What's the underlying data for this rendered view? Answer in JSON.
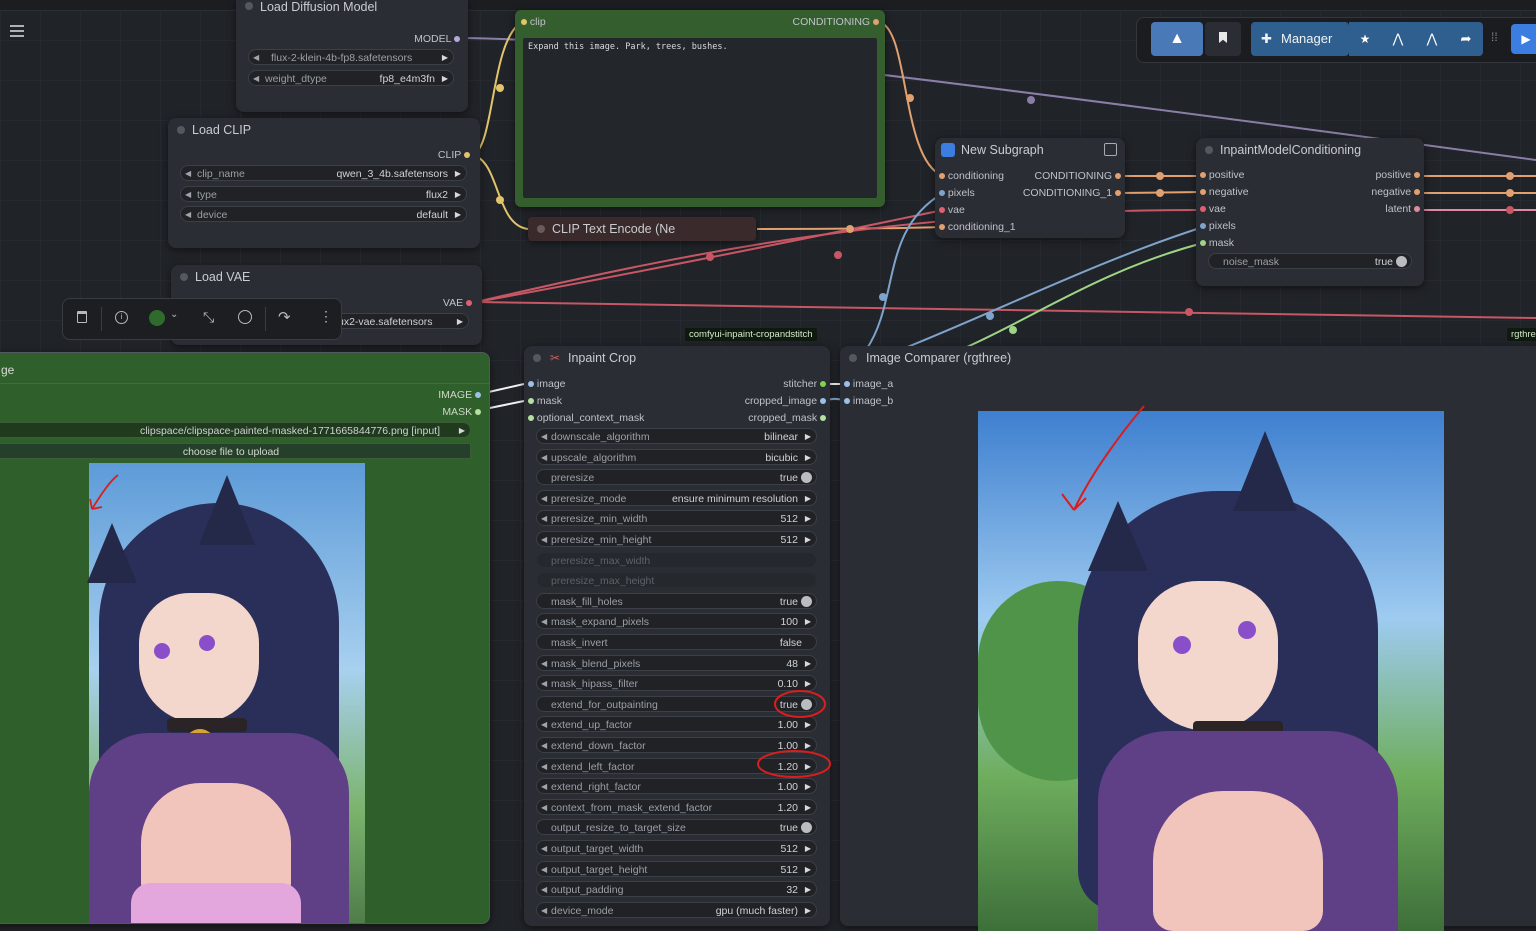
{
  "menu_icon": "hamburger-menu-icon",
  "toolbar": {
    "manager_label": "Manager",
    "icons": [
      "comfy-logo-icon",
      "bookmark-icon",
      "puzzle-icon",
      "star-icon",
      "lambda-icon",
      "lambda-alt-icon",
      "share-icon",
      "drag-handle-icon",
      "play-icon"
    ]
  },
  "selection_toolbar": {
    "icons": [
      "trash-icon",
      "info-icon",
      "color-dot-icon",
      "chevron-down-icon",
      "collapse-icon",
      "bypass-icon",
      "redo-icon",
      "more-icon"
    ],
    "color": "#2f6b2c"
  },
  "nodes": {
    "load_diffusion": {
      "title": "Load Diffusion Model",
      "output": "MODEL",
      "widgets": [
        {
          "label": "",
          "value": "flux-2-klein-4b-fp8.safetensors"
        },
        {
          "label": "weight_dtype",
          "value": "fp8_e4m3fn"
        }
      ]
    },
    "load_clip": {
      "title": "Load CLIP",
      "output": "CLIP",
      "widgets": [
        {
          "label": "clip_name",
          "value": "qwen_3_4b.safetensors"
        },
        {
          "label": "type",
          "value": "flux2"
        },
        {
          "label": "device",
          "value": "default"
        }
      ]
    },
    "load_vae": {
      "title": "Load VAE",
      "output": "VAE",
      "widget_value": "ux2-vae.safetensors"
    },
    "clip_text_positive": {
      "input": "clip",
      "output": "CONDITIONING",
      "text": "Expand this image. Park, trees, bushes."
    },
    "clip_text_collapsed": {
      "title": "CLIP Text Encode (Ne"
    },
    "new_subgraph": {
      "title": "New Subgraph",
      "inputs": [
        "conditioning",
        "pixels",
        "vae",
        "conditioning_1"
      ],
      "outputs": [
        "CONDITIONING",
        "CONDITIONING_1"
      ]
    },
    "inpaint_model_conditioning": {
      "title": "InpaintModelConditioning",
      "inputs": [
        "positive",
        "negative",
        "vae",
        "pixels",
        "mask"
      ],
      "outputs": [
        "positive",
        "negative",
        "latent"
      ],
      "widget": {
        "label": "noise_mask",
        "value": "true"
      }
    },
    "load_image": {
      "title": "ge",
      "outputs": [
        "IMAGE",
        "MASK"
      ],
      "image_path": "clipspace/clipspace-painted-masked-1771665844776.png [input]",
      "upload_label": "choose file to upload"
    },
    "inpaint_crop": {
      "badge": "comfyui-inpaint-cropandstitch",
      "title": "Inpaint Crop",
      "inputs": [
        "image",
        "mask",
        "optional_context_mask"
      ],
      "outputs": [
        "stitcher",
        "cropped_image",
        "cropped_mask"
      ],
      "widgets": [
        {
          "label": "downscale_algorithm",
          "value": "bilinear",
          "kind": "combo"
        },
        {
          "label": "upscale_algorithm",
          "value": "bicubic",
          "kind": "combo"
        },
        {
          "label": "preresize",
          "value": "true",
          "kind": "toggle"
        },
        {
          "label": "preresize_mode",
          "value": "ensure minimum resolution",
          "kind": "combo"
        },
        {
          "label": "preresize_min_width",
          "value": "512",
          "kind": "number"
        },
        {
          "label": "preresize_min_height",
          "value": "512",
          "kind": "number"
        },
        {
          "label": "preresize_max_width",
          "value": "",
          "kind": "disabled"
        },
        {
          "label": "preresize_max_height",
          "value": "",
          "kind": "disabled"
        },
        {
          "label": "mask_fill_holes",
          "value": "true",
          "kind": "toggle"
        },
        {
          "label": "mask_expand_pixels",
          "value": "100",
          "kind": "number"
        },
        {
          "label": "mask_invert",
          "value": "false",
          "kind": "toggle_off"
        },
        {
          "label": "mask_blend_pixels",
          "value": "48",
          "kind": "number"
        },
        {
          "label": "mask_hipass_filter",
          "value": "0.10",
          "kind": "number"
        },
        {
          "label": "extend_for_outpainting",
          "value": "true",
          "kind": "toggle"
        },
        {
          "label": "extend_up_factor",
          "value": "1.00",
          "kind": "number"
        },
        {
          "label": "extend_down_factor",
          "value": "1.00",
          "kind": "number"
        },
        {
          "label": "extend_left_factor",
          "value": "1.20",
          "kind": "number"
        },
        {
          "label": "extend_right_factor",
          "value": "1.00",
          "kind": "number"
        },
        {
          "label": "context_from_mask_extend_factor",
          "value": "1.20",
          "kind": "number"
        },
        {
          "label": "output_resize_to_target_size",
          "value": "true",
          "kind": "toggle"
        },
        {
          "label": "output_target_width",
          "value": "512",
          "kind": "number"
        },
        {
          "label": "output_target_height",
          "value": "512",
          "kind": "number"
        },
        {
          "label": "output_padding",
          "value": "32",
          "kind": "number"
        },
        {
          "label": "device_mode",
          "value": "gpu (much faster)",
          "kind": "combo"
        }
      ]
    },
    "image_comparer": {
      "title": "Image Comparer (rgthree)",
      "inputs": [
        "image_a",
        "image_b"
      ],
      "badge": "rgthre"
    }
  },
  "colors": {
    "canvas": "#202328",
    "node_bg": "#2a2d33",
    "green_node": "#355e2f",
    "annotation": "#d81e1e"
  }
}
